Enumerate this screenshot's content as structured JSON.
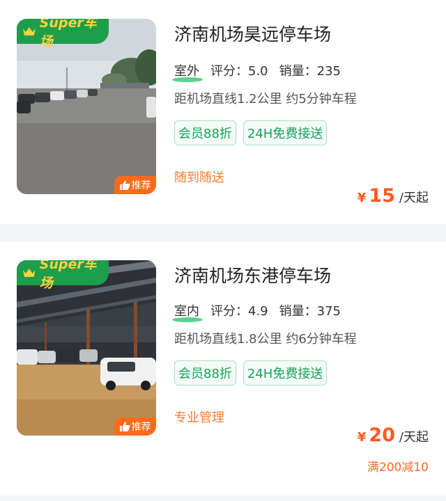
{
  "listings": [
    {
      "badge": "Super车场",
      "recommend": "推荐",
      "title": "济南机场昊远停车场",
      "type": "室外",
      "rating_label": "评分：5.0",
      "sales_label": "销量：235",
      "distance": "距机场直线1.2公里 约5分钟车程",
      "tags": [
        "会员88折",
        "24H免费接送"
      ],
      "feature": "随到随送",
      "currency": "¥",
      "price": "15",
      "price_unit": "/天起"
    },
    {
      "badge": "Super车场",
      "recommend": "推荐",
      "title": "济南机场东港停车场",
      "type": "室内",
      "rating_label": "评分：4.9",
      "sales_label": "销量：375",
      "distance": "距机场直线1.8公里 约6分钟车程",
      "tags": [
        "会员88折",
        "24H免费接送"
      ],
      "feature": "专业管理",
      "currency": "¥",
      "price": "20",
      "price_unit": "/天起",
      "discount": "满200减10"
    }
  ],
  "colors": {
    "badge_green": "#1e9d4a",
    "badge_text": "#ffd23f",
    "recommend_orange": "#ff6a1a",
    "tag_green": "#18a058",
    "price_orange": "#ff5a1f",
    "feature_orange": "#ff7a2a"
  }
}
